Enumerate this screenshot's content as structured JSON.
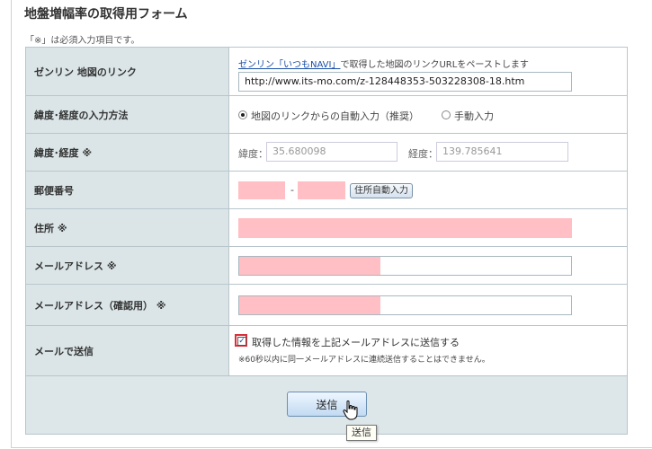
{
  "title": "地盤増幅率の取得用フォーム",
  "required_note": "「※」は必須入力項目です。",
  "rows": {
    "map_link": {
      "label": "ゼンリン 地図のリンク",
      "help_link": "ゼンリン「いつもNAVI」",
      "help_text": "で取得した地図のリンクURLをペーストします",
      "url_value": "http://www.its-mo.com/z-128448353-503228308-18.htm"
    },
    "input_method": {
      "label": "緯度･経度の入力方法",
      "option_auto": "地図のリンクからの自動入力（推奨）",
      "option_manual": "手動入力",
      "selected": "auto"
    },
    "latlng": {
      "label": "緯度･経度 ※",
      "lat_label": "緯度：",
      "lat_value": "35.680098",
      "lng_label": "経度：",
      "lng_value": "139.785641"
    },
    "postal": {
      "label": "郵便番号",
      "separator": "-",
      "auto_button": "住所自動入力"
    },
    "address": {
      "label": "住所 ※"
    },
    "email": {
      "label": "メールアドレス ※"
    },
    "email_confirm": {
      "label": "メールアドレス（確認用） ※"
    },
    "send_mail": {
      "label": "メールで送信",
      "checkbox_label": "取得した情報を上記メールアドレスに送信する",
      "checked": true,
      "note": "※60秒以内に同一メールアドレスに連続送信することはできません。"
    }
  },
  "submit_button": "送信",
  "tooltip": "送信",
  "colors": {
    "required_field": "#ffbfc4",
    "label_bg": "#dbe5e7",
    "checkbox_highlight": "#d9303a"
  }
}
